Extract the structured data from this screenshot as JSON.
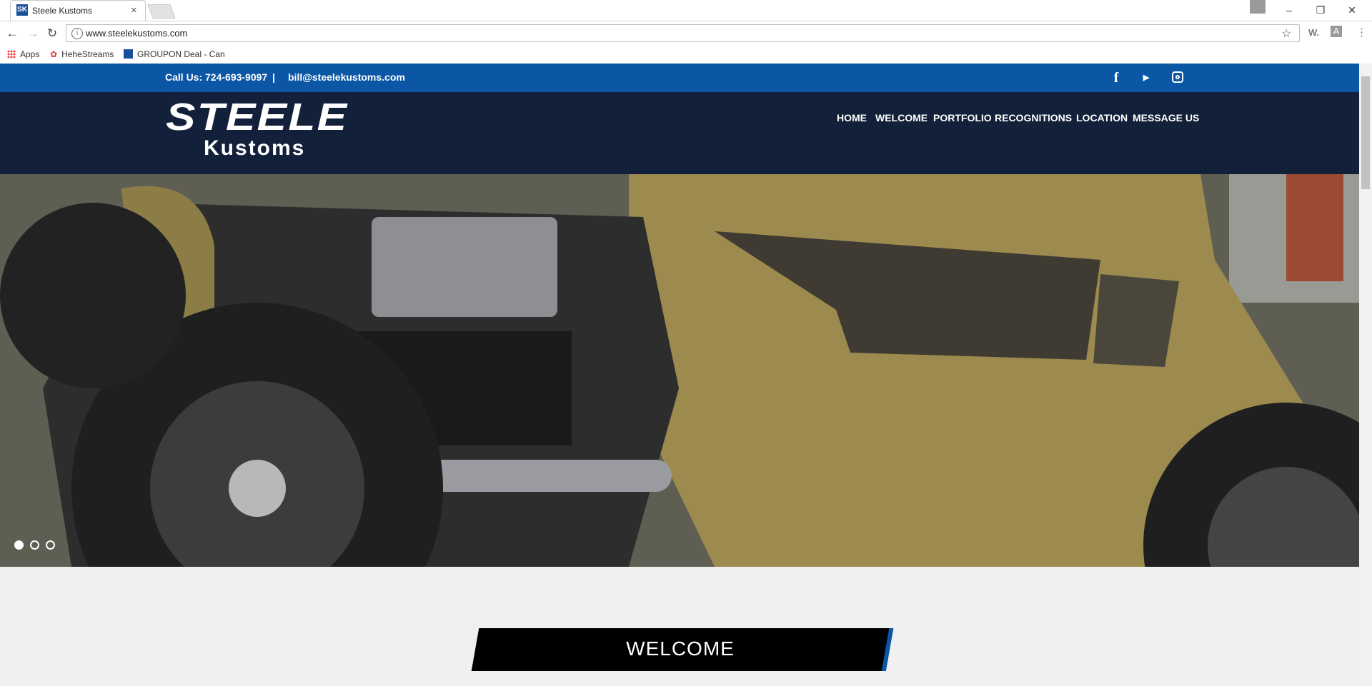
{
  "browser": {
    "tab_title": "Steele Kustoms",
    "tab_favicon": "SK",
    "url": "www.steelekustoms.com",
    "bookmarks": [
      {
        "label": "Apps"
      },
      {
        "label": "HeheStreams"
      },
      {
        "label": "GROUPON Deal - Can"
      }
    ]
  },
  "topbar": {
    "phone": "Call Us: 724-693-9097",
    "separator": "|",
    "email": "bill@steelekustoms.com",
    "social": [
      "facebook-icon",
      "youtube-icon",
      "instagram-icon"
    ]
  },
  "header": {
    "logo_line1": "STEELE",
    "logo_line2": "Kustoms",
    "menu": [
      "HOME",
      "WELCOME",
      "PORTFOLIO",
      "RECOGNITIONS",
      "LOCATION",
      "MESSAGE US"
    ]
  },
  "hero": {
    "slide_count": 3,
    "active_slide": 1
  },
  "section": {
    "welcome_title": "WELCOME"
  },
  "colors": {
    "topbar": "#0b57a6",
    "header": "#13203a",
    "page_bg": "#f0f0f0"
  }
}
